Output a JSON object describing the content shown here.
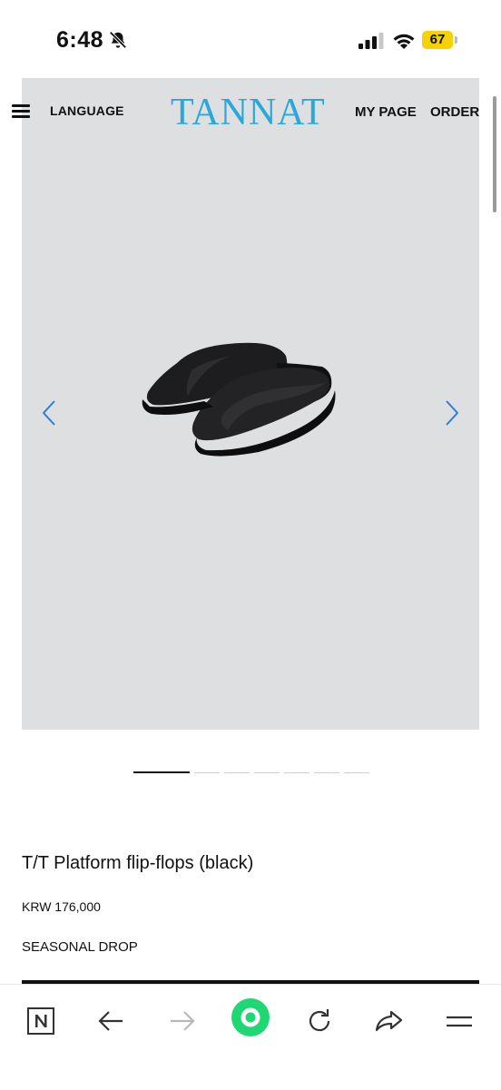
{
  "status_bar": {
    "time": "6:48",
    "battery": "67",
    "icons": [
      "bell-slash-icon",
      "signal-icon",
      "wifi-icon",
      "battery-icon"
    ]
  },
  "header": {
    "menu_icon": "hamburger-icon",
    "language_label": "LANGUAGE",
    "logo_text": "TANNAT",
    "my_page_label": "MY PAGE",
    "order_label": "ORDER"
  },
  "gallery": {
    "prev_icon": "chevron-left-icon",
    "next_icon": "chevron-right-icon",
    "slide_count": 7,
    "active_slide": 1
  },
  "product": {
    "name": "T/T Platform flip-flops (black)",
    "price": "KRW 176,000",
    "tag": "SEASONAL DROP"
  },
  "browser_toolbar": {
    "items": [
      "naver-icon",
      "back-icon",
      "forward-icon",
      "home-icon",
      "reload-icon",
      "share-icon",
      "menu-icon"
    ]
  },
  "colors": {
    "logo": "#2aa7db",
    "arrows": "#2e7fd8",
    "image_background": "#dedfe1",
    "home_button": "#1fd873"
  }
}
